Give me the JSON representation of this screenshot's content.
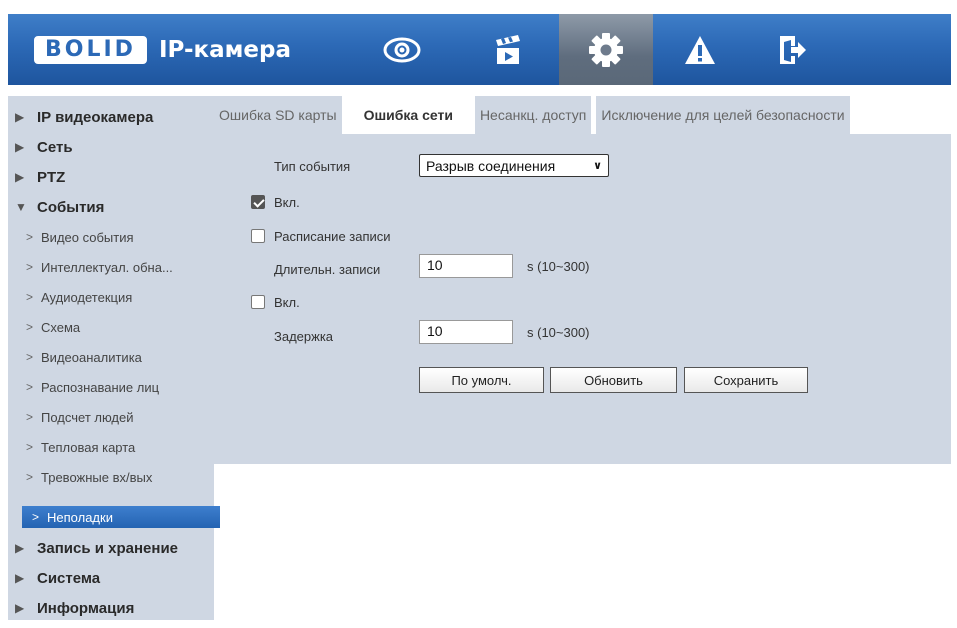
{
  "header": {
    "logo_text": "BOLID",
    "product_title": "IP-камера",
    "nav_icons": [
      "eye-icon",
      "clapperboard-icon",
      "gear-icon",
      "warning-icon",
      "logout-icon"
    ],
    "active_icon": "gear-icon"
  },
  "sidebar": {
    "items": [
      {
        "label": "IP видеокамера",
        "expanded": false
      },
      {
        "label": "Сеть",
        "expanded": false
      },
      {
        "label": "PTZ",
        "expanded": false
      },
      {
        "label": "События",
        "expanded": true
      },
      {
        "label": "Запись и хранение",
        "expanded": false
      },
      {
        "label": "Система",
        "expanded": false
      },
      {
        "label": "Информация",
        "expanded": false
      }
    ],
    "sub_items": [
      "Видео события",
      "Интеллектуал. обна...",
      "Аудиодетекция",
      "Схема",
      "Видеоаналитика",
      "Распознавание лиц",
      "Подсчет людей",
      "Тепловая карта",
      "Тревожные вх/вых",
      "Неполадки"
    ],
    "selected_sub": "Неполадки"
  },
  "tabs": [
    {
      "label": "Ошибка SD карты",
      "active": false
    },
    {
      "label": "Ошибка сети",
      "active": true
    },
    {
      "label": "Несанкц. доступ",
      "active": false
    },
    {
      "label": "Исключение для целей безопасности",
      "active": false
    }
  ],
  "form": {
    "event_type_label": "Тип события",
    "event_type_value": "Разрыв соединения",
    "enable_label": "Вкл.",
    "enable_checked": true,
    "record_label": "Расписание записи",
    "record_checked": false,
    "record_duration_label": "Длительн. записи",
    "record_duration_value": "10",
    "record_duration_hint": "s (10~300)",
    "enable2_label": "Вкл.",
    "enable2_checked": false,
    "delay_label": "Задержка",
    "delay_value": "10",
    "delay_hint": "s (10~300)",
    "default_button": "По умолч.",
    "refresh_button": "Обновить",
    "save_button": "Сохранить"
  }
}
